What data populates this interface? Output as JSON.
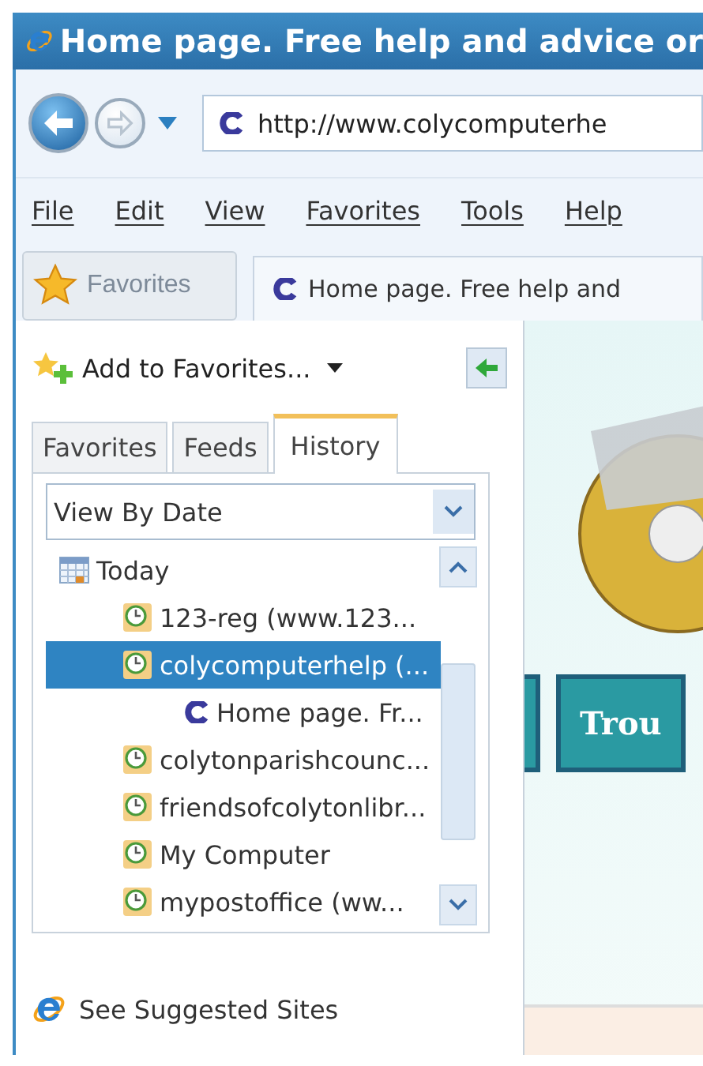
{
  "window": {
    "title": "Home page. Free help and advice or"
  },
  "address_bar": {
    "value": "http://www.colycomputerhe"
  },
  "menu": [
    "File",
    "Edit",
    "View",
    "Favorites",
    "Tools",
    "Help"
  ],
  "favorites_button": {
    "label": "Favorites"
  },
  "tab": {
    "title": "Home page. Free help and"
  },
  "panel": {
    "add_favorites": "Add to Favorites...",
    "tabs": [
      {
        "label": "Favorites",
        "selected": false
      },
      {
        "label": "Feeds",
        "selected": false
      },
      {
        "label": "History",
        "selected": true
      }
    ],
    "view": {
      "value": "View By Date"
    },
    "tree": [
      {
        "label": "Today",
        "kind": "calendar",
        "selected": false,
        "children": [
          {
            "label": "123-reg (www.123...",
            "kind": "history",
            "selected": false
          },
          {
            "label": "colycomputerhelp (...",
            "kind": "history",
            "selected": true,
            "children": [
              {
                "label": "Home page. Fr...",
                "kind": "page",
                "selected": false
              }
            ]
          },
          {
            "label": "colytonparishcounc...",
            "kind": "history",
            "selected": false
          },
          {
            "label": "friendsofcolytonlibr...",
            "kind": "history",
            "selected": false
          },
          {
            "label": "My Computer",
            "kind": "history",
            "selected": false
          },
          {
            "label": "mypostoffice (ww...",
            "kind": "history",
            "selected": false
          }
        ]
      }
    ],
    "footer": "See Suggested Sites"
  },
  "page": {
    "button": "Trou"
  }
}
